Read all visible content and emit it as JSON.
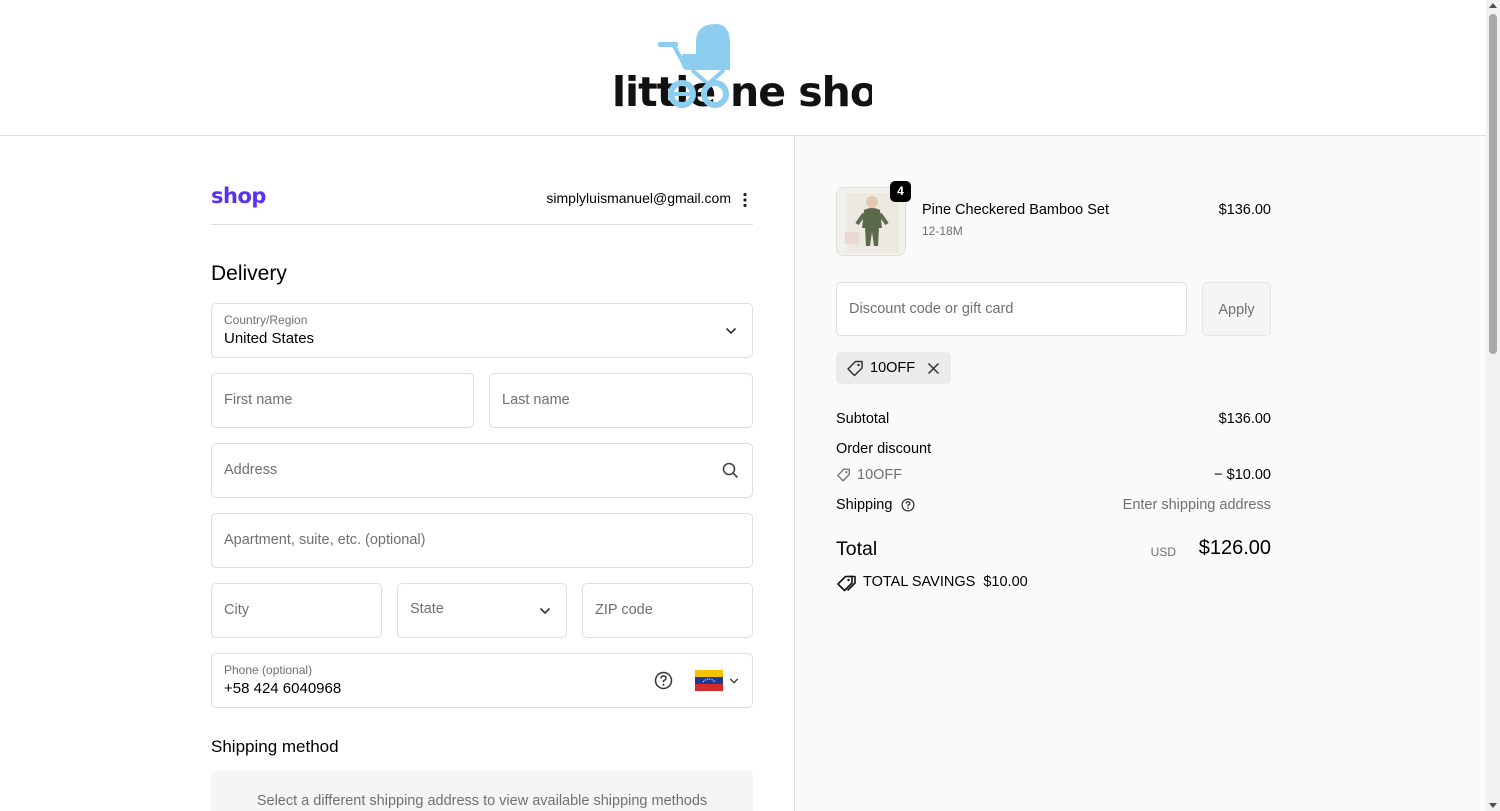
{
  "header": {
    "logo_text_a": "little",
    "logo_text_b": "ne shop"
  },
  "account": {
    "brand": "shop",
    "email": "simplyluismanuel@gmail.com"
  },
  "delivery": {
    "title": "Delivery",
    "country": {
      "label": "Country/Region",
      "value": "United States"
    },
    "first_name": {
      "placeholder": "First name"
    },
    "last_name": {
      "placeholder": "Last name"
    },
    "address": {
      "placeholder": "Address"
    },
    "apartment": {
      "placeholder": "Apartment, suite, etc. (optional)"
    },
    "city": {
      "placeholder": "City"
    },
    "state": {
      "placeholder": "State"
    },
    "zip": {
      "placeholder": "ZIP code"
    },
    "phone": {
      "label": "Phone (optional)",
      "value": "+58 424 6040968",
      "country_flag": "Venezuela"
    }
  },
  "shipping_method": {
    "title": "Shipping method",
    "message": "Select a different shipping address to view available shipping methods"
  },
  "order": {
    "item": {
      "name": "Pine Checkered Bamboo Set",
      "variant": "12-18M",
      "price": "$136.00",
      "quantity": "4"
    },
    "discount_placeholder": "Discount code or gift card",
    "apply_label": "Apply",
    "applied_code": "10OFF",
    "subtotal_label": "Subtotal",
    "subtotal_value": "$136.00",
    "order_discount_label": "Order discount",
    "discount_code": "10OFF",
    "discount_value": "− $10.00",
    "shipping_label": "Shipping",
    "shipping_value": "Enter shipping address",
    "total_label": "Total",
    "total_currency": "USD",
    "total_value": "$126.00",
    "savings_label": "TOTAL SAVINGS",
    "savings_value": "$10.00"
  },
  "colors": {
    "brand_shop": "#5a31f4",
    "logo_blue": "#8ccdf0",
    "border": "#dedede"
  }
}
